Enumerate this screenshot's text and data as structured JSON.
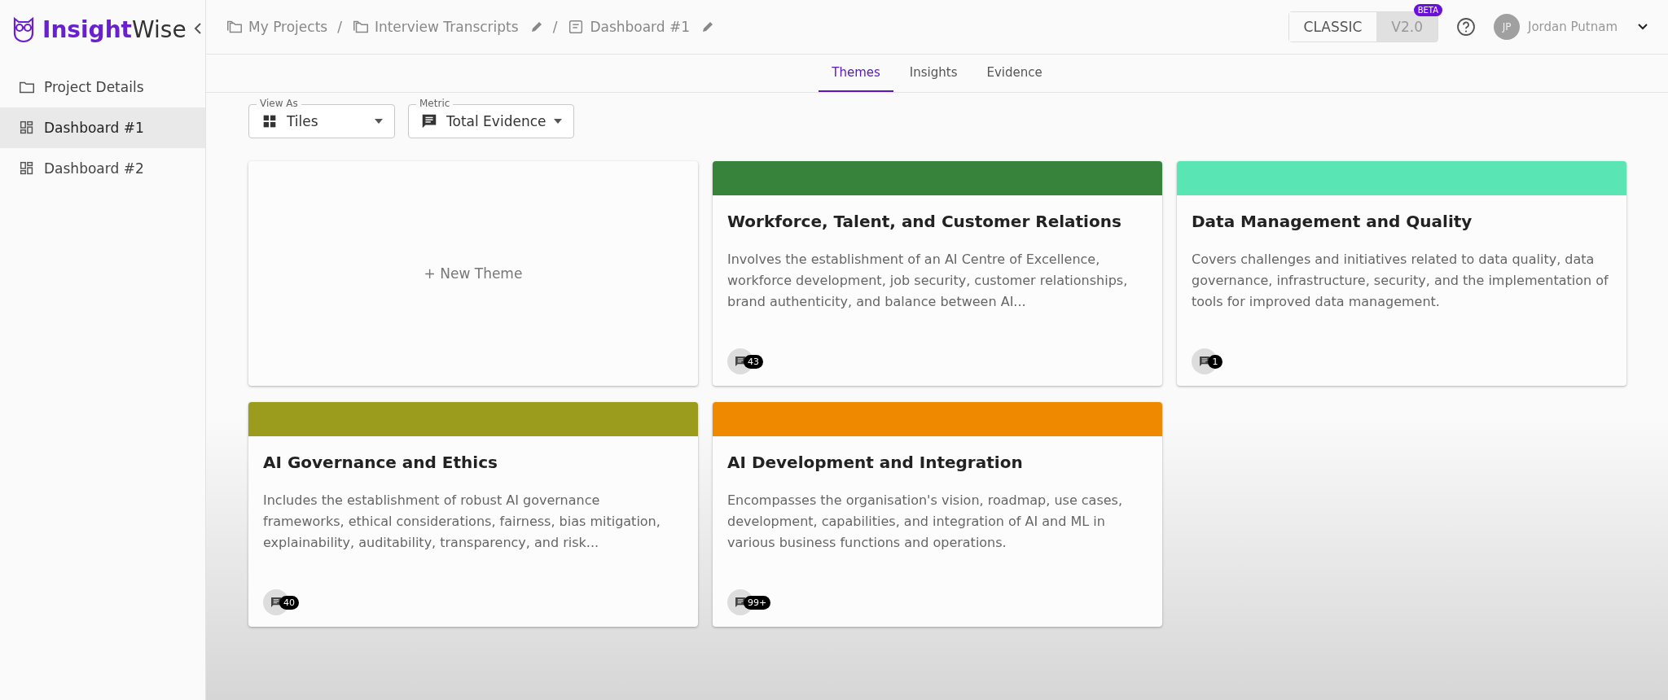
{
  "app": {
    "logo_bold": "Insight",
    "logo_light": "Wise"
  },
  "sidebar": {
    "items": [
      {
        "label": "Project Details",
        "kind": "folder",
        "selected": false
      },
      {
        "label": "Dashboard #1",
        "kind": "dashboard",
        "selected": true
      },
      {
        "label": "Dashboard #2",
        "kind": "dashboard",
        "selected": false
      }
    ]
  },
  "breadcrumb": [
    {
      "label": "My Projects",
      "kind": "folder",
      "editable": false
    },
    {
      "separator": "/",
      "label": "Interview Transcripts",
      "kind": "folder",
      "editable": true
    },
    {
      "separator": "/",
      "label": "Dashboard #1",
      "kind": "dashboard",
      "editable": true
    }
  ],
  "version_toggle": {
    "options": [
      {
        "label": "CLASSIC",
        "selected": false
      },
      {
        "label": "V2.0",
        "selected": true
      }
    ],
    "badge": "BETA"
  },
  "user": {
    "initials": "JP",
    "name": "Jordan Putnam"
  },
  "tabs": [
    {
      "label": "Themes",
      "selected": true
    },
    {
      "label": "Insights",
      "selected": false
    },
    {
      "label": "Evidence",
      "selected": false
    }
  ],
  "filters": [
    {
      "label": "View As",
      "value": "Tiles",
      "kind": "tiles"
    },
    {
      "label": "Metric",
      "value": "Total Evidence",
      "kind": "comment"
    }
  ],
  "new_theme": "+ New Theme",
  "themes": [
    {
      "title": "Workforce, Talent, and Customer Relations",
      "color": "#37833c",
      "description": "Involves the establishment of an AI Centre of Excellence, workforce development, job security, customer relationships, brand authenticity, and balance between AI...",
      "count": "43"
    },
    {
      "title": "Data Management and Quality",
      "color": "#5ae6b4",
      "description": "Covers challenges and initiatives related to data quality, data governance, infrastructure, security, and the implementation of tools for improved data management.",
      "count": "1"
    },
    {
      "title": "AI Governance and Ethics",
      "color": "#9b9c1e",
      "description": "Includes the establishment of robust AI governance frameworks, ethical considerations, fairness, bias mitigation, explainability, auditability, transparency, and risk...",
      "count": "40"
    },
    {
      "title": "AI Development and Integration",
      "color": "#ef8a00",
      "description": "Encompasses the organisation's vision, roadmap, use cases, development, capabilities, and integration of AI and ML in various business functions and operations.",
      "count": "99+"
    }
  ]
}
